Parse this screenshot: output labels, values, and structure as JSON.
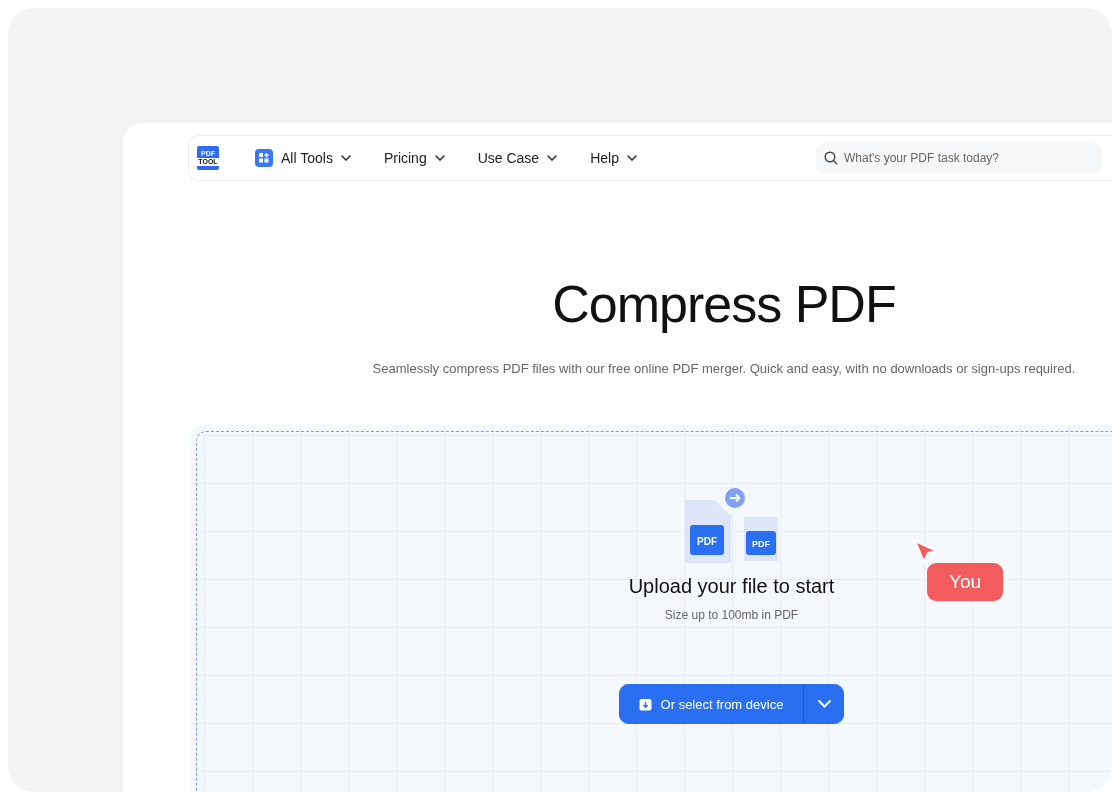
{
  "logo": {
    "lines": [
      "PDF",
      "TOOL"
    ]
  },
  "nav": [
    {
      "label": "All Tools",
      "kind": "apps"
    },
    {
      "label": "Pricing",
      "kind": "plain"
    },
    {
      "label": "Use Case",
      "kind": "plain"
    },
    {
      "label": "Help",
      "kind": "plain"
    }
  ],
  "search": {
    "placeholder": "What's your PDF task today?"
  },
  "hero": {
    "title": "Compress PDF",
    "subtitle": "Seamlessly compress PDF files with our free online PDF merger. Quick and easy, with no downloads or sign-ups required."
  },
  "upload": {
    "title": "Upload your file to start",
    "hint": "Size up to 100mb in PDF",
    "button": "Or select from device",
    "file_labels": [
      "PDF",
      "PDF"
    ]
  },
  "cursor": {
    "label": "You"
  }
}
